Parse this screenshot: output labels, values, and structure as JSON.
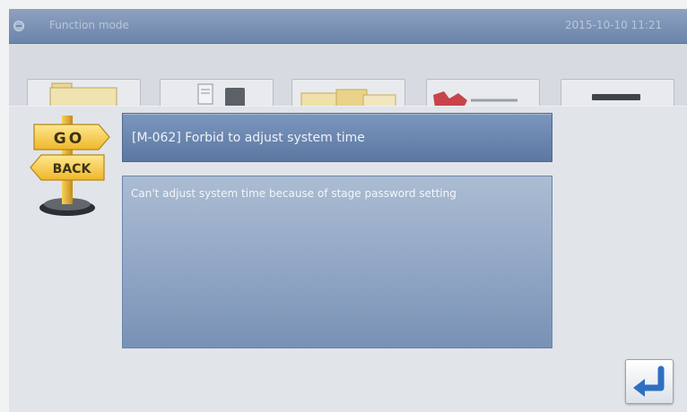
{
  "window": {
    "title": "Function mode",
    "datetime": "2015-10-10 11:21",
    "collapse_icon": "collapse-icon"
  },
  "tabs": [
    {
      "icon": "folder-icon"
    },
    {
      "icon": "document-icon",
      "icon2": "storage-icon"
    },
    {
      "icon": "folder-open-icon"
    },
    {
      "icon": "tool-icon"
    },
    {
      "icon": "bar-icon"
    }
  ],
  "dialog": {
    "sign": {
      "icon": "go-back-sign-icon",
      "top_label": "GO",
      "bottom_label": "BACK"
    },
    "code_title": "[M-062] Forbid to adjust system time",
    "message": "Can't adjust system time because of stage password setting",
    "confirm_icon": "enter-return-icon"
  },
  "colors": {
    "title_bar": "#7a91b3",
    "code_box": "#6a87b0",
    "message_box": "#93a8c6",
    "sign_yellow": "#f2c232",
    "enter_arrow": "#2e6fc2"
  }
}
